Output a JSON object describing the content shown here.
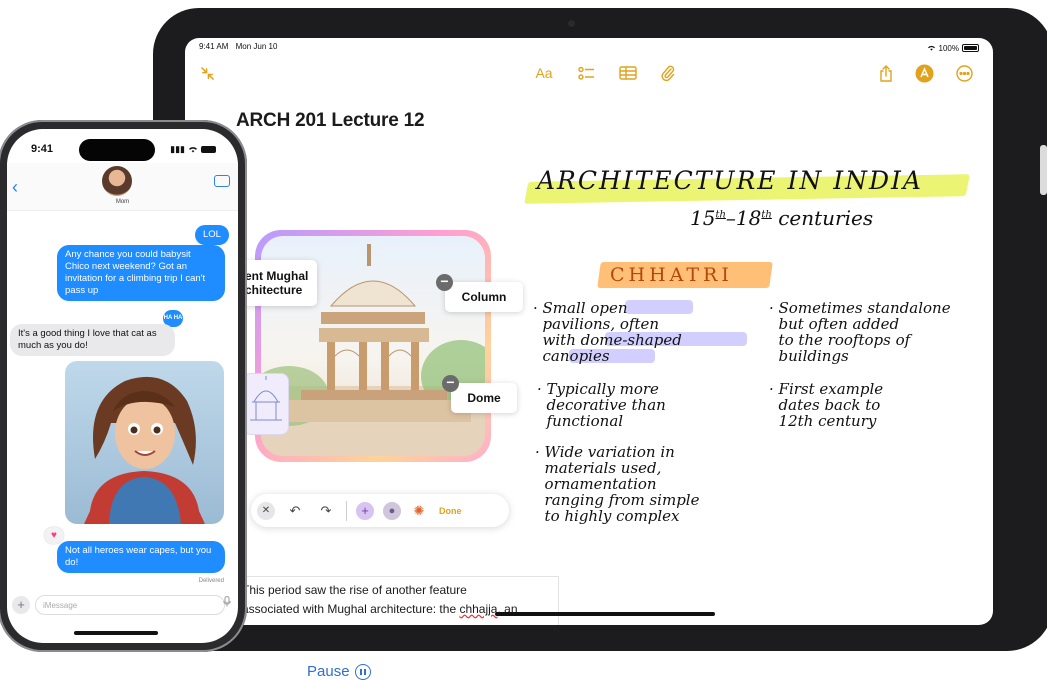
{
  "ipad": {
    "status_time": "9:41 AM",
    "status_date": "Mon Jun 10",
    "battery": "100%",
    "toolbar": {
      "collapse_icon": "collapse-arrows-icon",
      "format_label": "Aa",
      "checklist_icon": "checklist-icon",
      "table_icon": "table-icon",
      "attachment_icon": "paperclip-icon",
      "share_icon": "share-icon",
      "markup_icon": "markup-pen-icon",
      "more_icon": "ellipsis-circle-icon",
      "compose_icon": "compose-icon"
    },
    "note_title": "ARCH 201 Lecture 12",
    "handwriting": {
      "heading": "ARCHITECTURE IN INDIA",
      "subheading_left": "15",
      "subheading_sup1": "th",
      "subheading_mid": "–18",
      "subheading_sup2": "th",
      "subheading_right": "centuries",
      "section": "CHHATRI",
      "bullet1": "· Small open\n  pavilions, often\n  with dome-shaped\n  canopies",
      "bullet2": "· Typically more\n  decorative than\n  functional",
      "bullet3": "· Wide variation in\n  materials used,\n  ornamentation\n  ranging from simple\n  to highly complex",
      "bullet4": "· Sometimes standalone\n  but often added\n  to the rooftops of\n  buildings",
      "bullet5": "· First example\n  dates back to\n  12th century"
    },
    "image_labels": {
      "left_label": "ent Mughal\nchitecture",
      "column": "Column",
      "dome": "Dome"
    },
    "image_toolbar": {
      "done_label": "Done"
    },
    "body_text_line1": "This period saw the rise of another feature",
    "body_text_line2_prefix": "associated with Mughal architecture: the ",
    "body_text_line2_word": "chhajja",
    "body_text_line2_suffix": ", an"
  },
  "iphone": {
    "time": "9:41",
    "contact_name": "Mom",
    "messages": {
      "lol": "LOL",
      "babysit": "Any chance you could babysit Chico next weekend? Got an invitation for a climbing trip I can't pass up",
      "reply": "It's a good thing I love that cat as much as you do!",
      "ha_badge": "HA HA",
      "heroes": "Not all heroes wear capes, but you do!",
      "delivered": "Delivered"
    },
    "input_placeholder": "iMessage"
  },
  "pause_label": "Pause",
  "colors": {
    "accent_ipad": "#e2a21b",
    "imessage_blue": "#1f8cff",
    "highlight_yellow": "#e9f25b",
    "highlight_orange": "#ffb867",
    "highlight_blue": "#c7c3ff",
    "link_blue": "#2f6fd1"
  }
}
